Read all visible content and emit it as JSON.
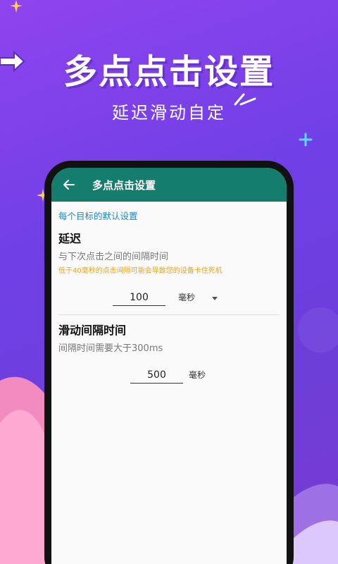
{
  "banner": {
    "title": "多点点击设置",
    "subtitle": "延迟滑动自定"
  },
  "app_bar": {
    "title": "多点点击设置",
    "back_icon": "arrow-left-icon",
    "color": "#147d6e"
  },
  "section": {
    "header": "每个目标的默认设置"
  },
  "delay": {
    "title": "延迟",
    "description": "与下次点击之间的间隔时间",
    "warning": "低于40毫秒的点击间隔可能会导致您的设备卡住死机",
    "value": "100",
    "unit": "毫秒"
  },
  "swipe": {
    "title": "滑动间隔时间",
    "description": "间隔时间需要大于300ms",
    "value": "500",
    "unit": "毫秒"
  },
  "colors": {
    "accent": "#1d86c9",
    "warning": "#e6a320",
    "background_purple": "#7a42e6"
  }
}
